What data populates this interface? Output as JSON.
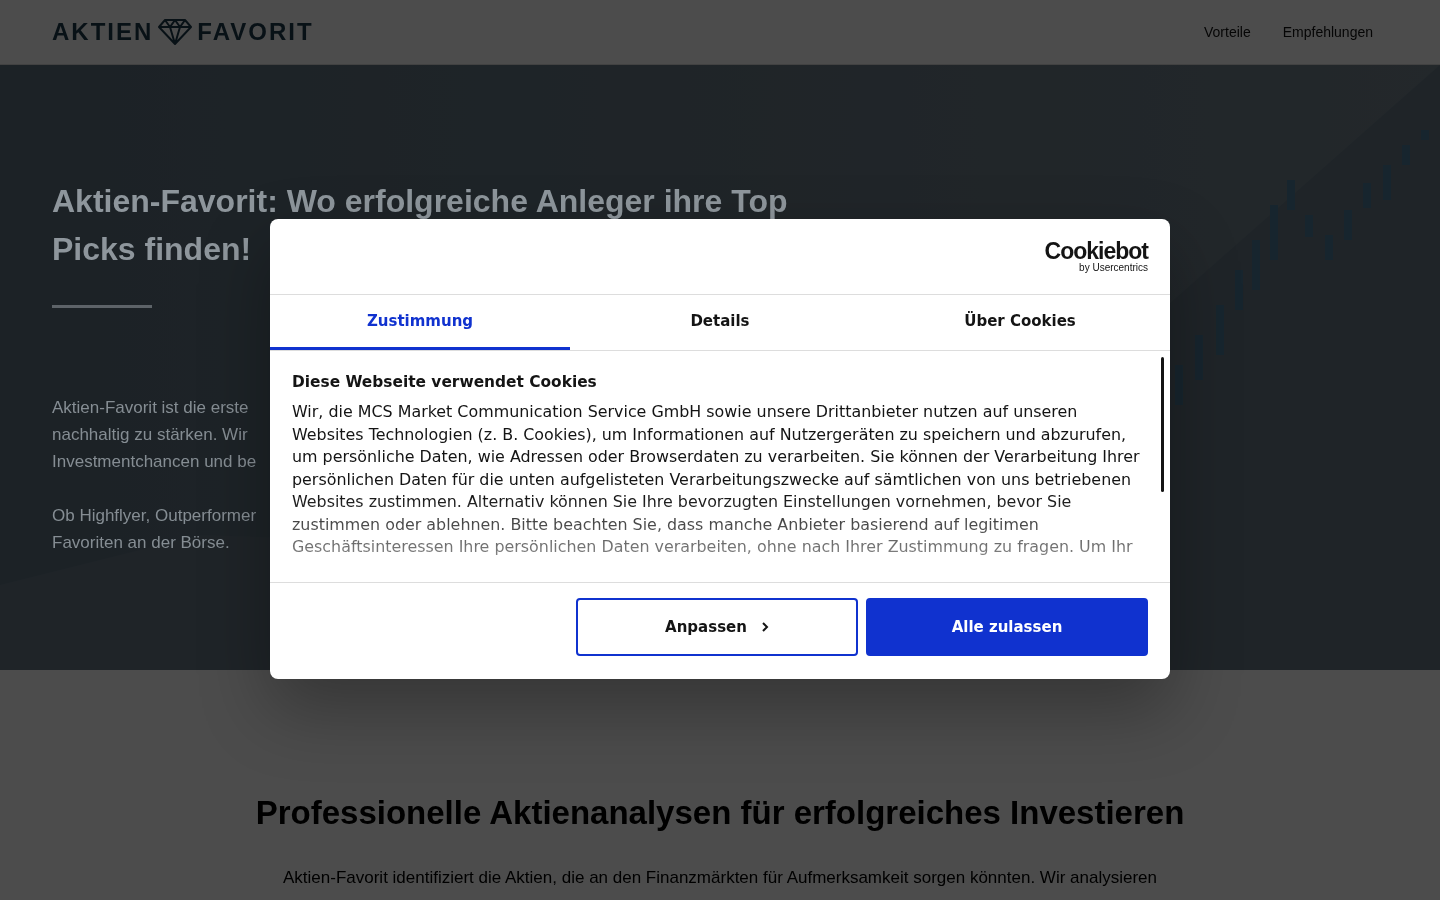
{
  "header": {
    "logo": {
      "left": "AKTIEN",
      "right": "FAVORIT"
    },
    "nav": [
      "Vorteile",
      "Empfehlungen"
    ]
  },
  "hero": {
    "heading_lines": [
      "Aktien-Favorit: Wo erfolgreiche Anleger ihre Top",
      "Picks finden!"
    ],
    "paragraphs": [
      [
        "Aktien-Favorit ist die erste",
        "nachhaltig zu stärken. Wir",
        "Investmentchancen und be"
      ],
      [
        "Ob Highflyer, Outperformer",
        "Favoriten an der Börse."
      ]
    ]
  },
  "section": {
    "heading": "Professionelle Aktienanalysen für erfolgreiches Investieren",
    "text": "Aktien-Favorit identifiziert die Aktien, die an den Finanzmärkten für Aufmerksamkeit sorgen könnten. Wir analysieren"
  },
  "cookie_dialog": {
    "brand": {
      "name": "Cookiebot",
      "byline": "by Usercentrics"
    },
    "tabs": [
      {
        "label": "Zustimmung",
        "selected": true
      },
      {
        "label": "Details",
        "selected": false
      },
      {
        "label": "Über Cookies",
        "selected": false
      }
    ],
    "title": "Diese Webseite verwendet Cookies",
    "text": "Wir, die MCS Market Communication Service GmbH sowie unsere Drittanbieter nutzen auf unseren Websites Technologien (z. B. Cookies), um Informationen auf Nutzergeräten zu speichern und abzurufen, um persönliche Daten, wie Adressen oder Browserdaten zu verarbeiten. Sie können der Verarbeitung Ihrer persönlichen Daten für die unten aufgelisteten Verarbeitungszwecke auf sämtlichen von uns betriebenen Websites zustimmen. Alternativ können Sie Ihre bevorzugten Einstellungen vornehmen, bevor Sie zustimmen oder ablehnen. Bitte beachten Sie, dass manche Anbieter basierend auf legitimen Geschäftsinteressen Ihre persönlichen Daten verarbeiten, ohne nach Ihrer Zustimmung zu fragen. Um Ihr",
    "buttons": [
      {
        "label": "Anpassen",
        "kind": "outline"
      },
      {
        "label": "Alle zulassen",
        "kind": "primary"
      }
    ]
  }
}
